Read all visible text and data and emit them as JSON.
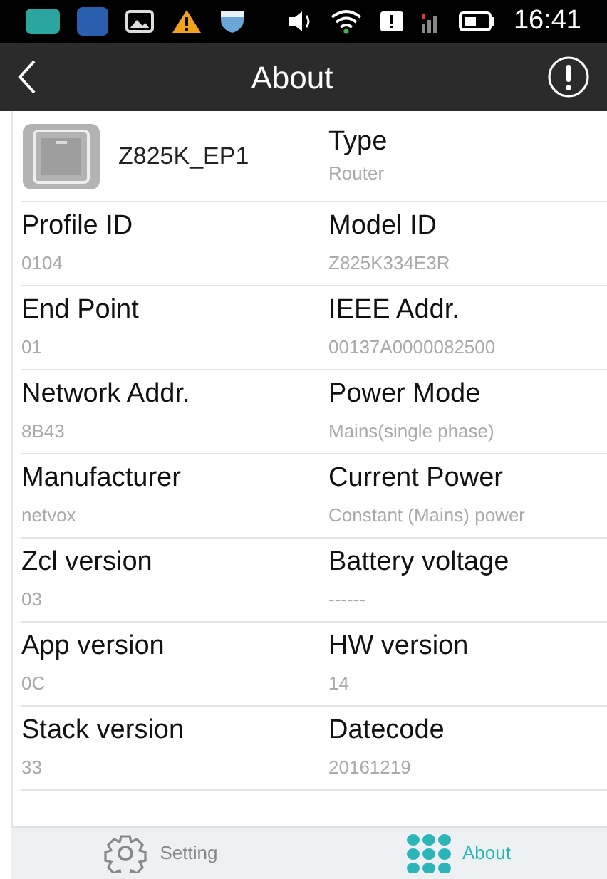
{
  "status_bar": {
    "time": "16:41"
  },
  "header": {
    "title": "About"
  },
  "device": {
    "name": "Z825K_EP1",
    "label": "Type",
    "value": "Router"
  },
  "rows": [
    [
      {
        "label": "Profile ID",
        "value": "0104"
      },
      {
        "label": "Model ID",
        "value": "Z825K334E3R"
      }
    ],
    [
      {
        "label": "End Point",
        "value": "01"
      },
      {
        "label": "IEEE Addr.",
        "value": "00137A0000082500"
      }
    ],
    [
      {
        "label": "Network Addr.",
        "value": "8B43"
      },
      {
        "label": "Power Mode",
        "value": "Mains(single phase)"
      }
    ],
    [
      {
        "label": "Manufacturer",
        "value": "netvox"
      },
      {
        "label": "Current Power",
        "value": "Constant (Mains) power"
      }
    ],
    [
      {
        "label": "Zcl version",
        "value": "03"
      },
      {
        "label": "Battery voltage",
        "value": "------"
      }
    ],
    [
      {
        "label": "App version",
        "value": "0C"
      },
      {
        "label": "HW version",
        "value": "14"
      }
    ],
    [
      {
        "label": "Stack version",
        "value": "33"
      },
      {
        "label": "Datecode",
        "value": "20161219"
      }
    ]
  ],
  "tabs": [
    {
      "label": "Setting",
      "kind": "gear",
      "selected": false
    },
    {
      "label": "About",
      "kind": "grid",
      "selected": true
    }
  ]
}
